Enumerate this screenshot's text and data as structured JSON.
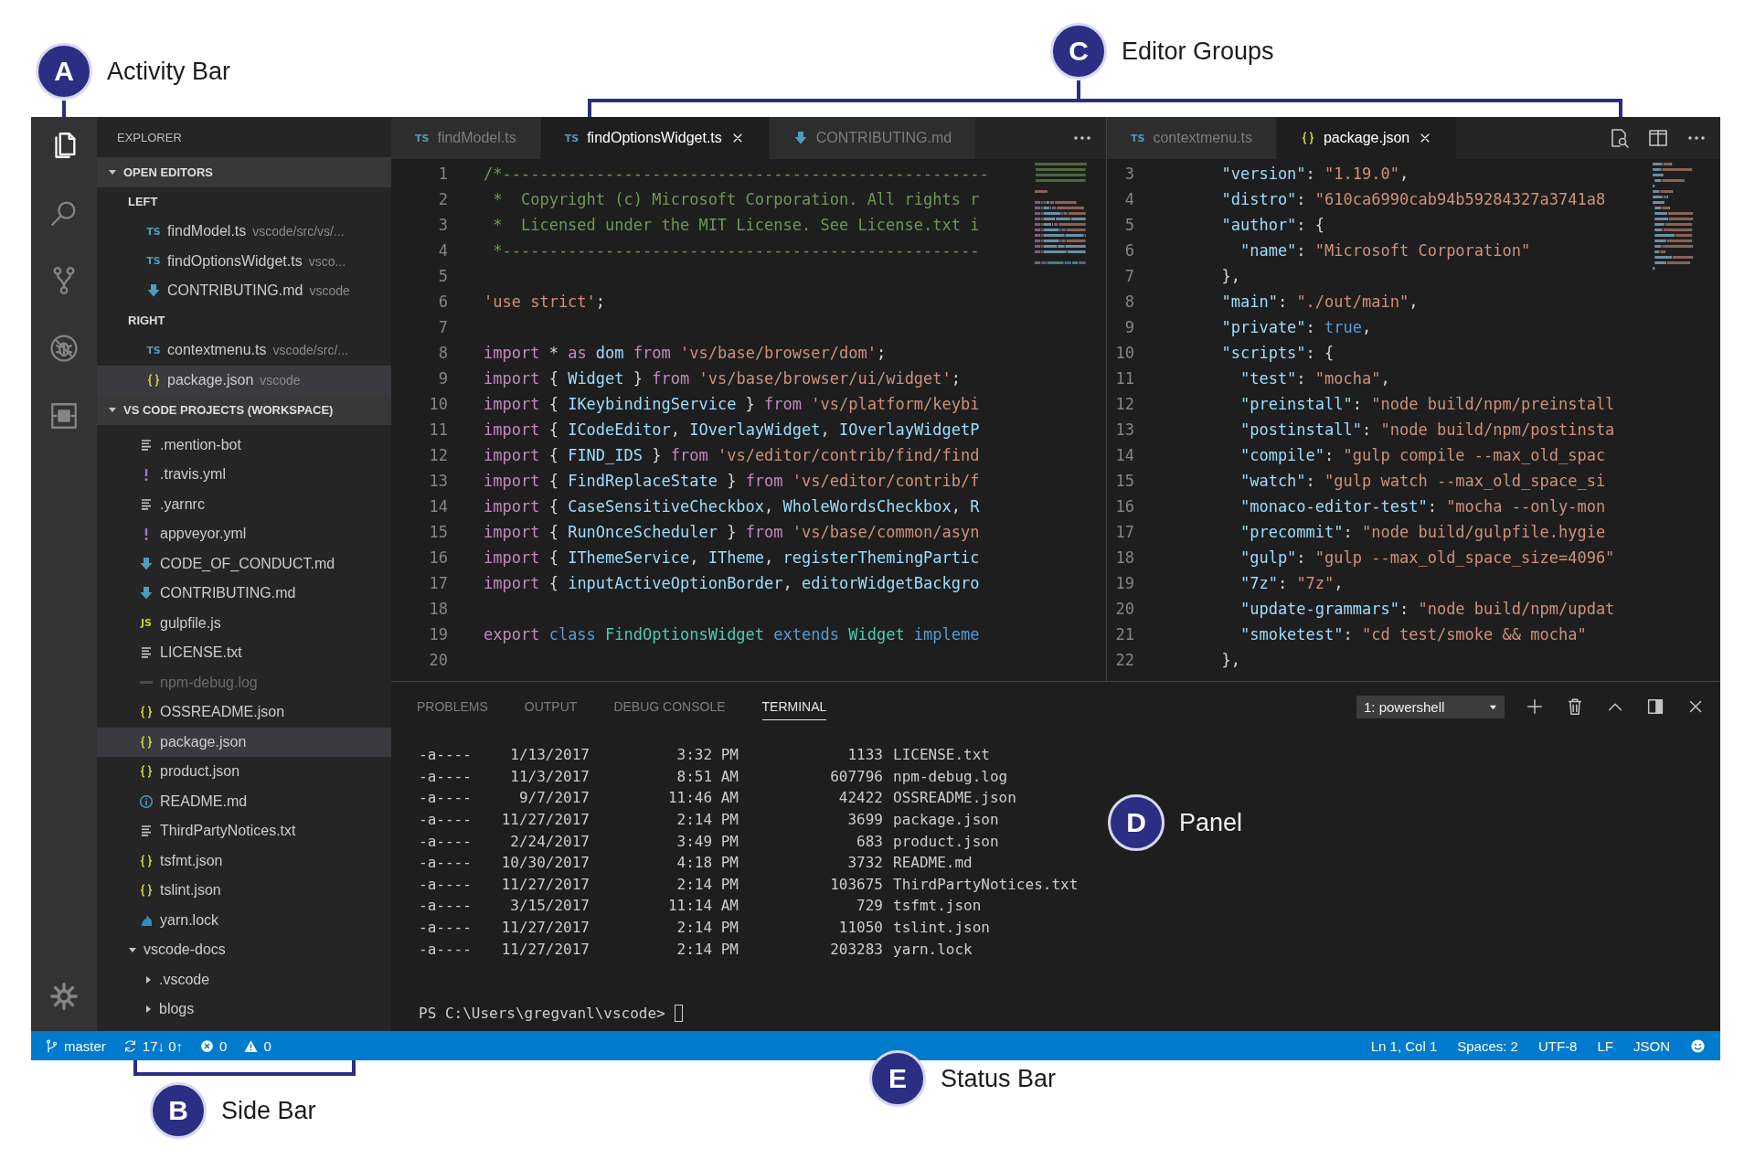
{
  "activity_bar": {
    "items": [
      {
        "kind": "files",
        "selected": true
      },
      {
        "kind": "search",
        "selected": false
      },
      {
        "kind": "source_control",
        "selected": false
      },
      {
        "kind": "debug",
        "selected": false
      },
      {
        "kind": "extensions",
        "selected": false
      }
    ]
  },
  "sidebar": {
    "title": "EXPLORER",
    "sections": [
      {
        "title": "OPEN EDITORS",
        "expanded": true,
        "groups": [
          {
            "title": "LEFT",
            "items": [
              {
                "name": "findModel.ts",
                "path": "vscode/src/vs/...",
                "kind": "ts",
                "badge": "TS",
                "selected": false
              },
              {
                "name": "findOptionsWidget.ts",
                "path": "vsco...",
                "kind": "ts",
                "badge": "TS",
                "selected": false
              },
              {
                "name": "CONTRIBUTING.md",
                "path": "vscode",
                "kind": "md",
                "selected": false
              }
            ]
          },
          {
            "title": "RIGHT",
            "items": [
              {
                "name": "contextmenu.ts",
                "path": "vscode/src/...",
                "kind": "ts",
                "badge": "TS",
                "selected": false
              },
              {
                "name": "package.json",
                "path": "vscode",
                "kind": "json",
                "selected": true
              }
            ]
          }
        ]
      },
      {
        "title": "VS CODE PROJECTS (WORKSPACE)",
        "expanded": true,
        "children": [
          {
            "kind": "txt",
            "name": ".mention-bot",
            "selected": false,
            "ignored": false
          },
          {
            "kind": "yml",
            "name": ".travis.yml",
            "selected": false,
            "ignored": false
          },
          {
            "kind": "txt",
            "name": ".yarnrc",
            "selected": false,
            "ignored": false
          },
          {
            "kind": "yml",
            "name": "appveyor.yml",
            "selected": false,
            "ignored": false
          },
          {
            "kind": "md",
            "name": "CODE_OF_CONDUCT.md",
            "selected": false,
            "ignored": false
          },
          {
            "kind": "md",
            "name": "CONTRIBUTING.md",
            "selected": false,
            "ignored": false
          },
          {
            "kind": "js",
            "name": "gulpfile.js",
            "badge": "JS",
            "selected": false,
            "ignored": false
          },
          {
            "kind": "txt",
            "name": "LICENSE.txt",
            "selected": false,
            "ignored": false
          },
          {
            "kind": "log",
            "name": "npm-debug.log",
            "selected": false,
            "ignored": true
          },
          {
            "kind": "json",
            "name": "OSSREADME.json",
            "selected": false,
            "ignored": false
          },
          {
            "kind": "json",
            "name": "package.json",
            "selected": true,
            "ignored": false
          },
          {
            "kind": "json",
            "name": "product.json",
            "selected": false,
            "ignored": false
          },
          {
            "kind": "info",
            "name": "README.md",
            "selected": false,
            "ignored": false
          },
          {
            "kind": "txt",
            "name": "ThirdPartyNotices.txt",
            "selected": false,
            "ignored": false
          },
          {
            "kind": "json",
            "name": "tsfmt.json",
            "selected": false,
            "ignored": false
          },
          {
            "kind": "json",
            "name": "tslint.json",
            "selected": false,
            "ignored": false
          },
          {
            "kind": "yarn",
            "name": "yarn.lock",
            "selected": false,
            "ignored": false
          },
          {
            "kind": "folder",
            "name": "vscode-docs",
            "expanded": true,
            "selected": false,
            "ignored": false,
            "children": [
              {
                "kind": "folder",
                "name": ".vscode",
                "expanded": false,
                "selected": false,
                "ignored": false
              },
              {
                "kind": "folder",
                "name": "blogs",
                "expanded": false,
                "selected": false,
                "ignored": false
              }
            ]
          }
        ]
      }
    ]
  },
  "editor_groups": [
    {
      "tabs": [
        {
          "name": "findModel.ts",
          "kind": "ts",
          "badge": "TS",
          "selected": false
        },
        {
          "name": "findOptionsWidget.ts",
          "kind": "ts",
          "badge": "TS",
          "selected": true
        },
        {
          "name": "CONTRIBUTING.md",
          "kind": "md",
          "selected": false
        }
      ],
      "actions": [
        {
          "kind": "more"
        }
      ],
      "lines": [
        {
          "number": "1",
          "tokens": [
            {
              "kind": "comment",
              "text": "/*----------------------------------------------------"
            }
          ]
        },
        {
          "number": "2",
          "tokens": [
            {
              "kind": "comment",
              "text": " *  Copyright (c) Microsoft Corporation. All rights r"
            }
          ]
        },
        {
          "number": "3",
          "tokens": [
            {
              "kind": "comment",
              "text": " *  Licensed under the MIT License. See License.txt i"
            }
          ]
        },
        {
          "number": "4",
          "tokens": [
            {
              "kind": "comment",
              "text": " *---------------------------------------------------"
            }
          ]
        },
        {
          "number": "5"
        },
        {
          "number": "6",
          "tokens": [
            {
              "kind": "string",
              "text": "'use strict'"
            },
            {
              "kind": "punct",
              "text": ";"
            }
          ]
        },
        {
          "number": "7"
        },
        {
          "number": "8",
          "tokens": [
            {
              "kind": "keyword",
              "text": "import"
            },
            {
              "kind": "punct",
              "text": " * "
            },
            {
              "kind": "keyword",
              "text": "as"
            },
            {
              "kind": "variable",
              "text": " dom "
            },
            {
              "kind": "keyword",
              "text": "from"
            },
            {
              "kind": "string",
              "text": " 'vs/base/browser/dom'"
            },
            {
              "kind": "punct",
              "text": ";"
            }
          ]
        },
        {
          "number": "9",
          "tokens": [
            {
              "kind": "keyword",
              "text": "import"
            },
            {
              "kind": "punct",
              "text": " { "
            },
            {
              "kind": "variable",
              "text": "Widget"
            },
            {
              "kind": "punct",
              "text": " } "
            },
            {
              "kind": "keyword",
              "text": "from"
            },
            {
              "kind": "string",
              "text": " 'vs/base/browser/ui/widget'"
            },
            {
              "kind": "punct",
              "text": ";"
            }
          ]
        },
        {
          "number": "10",
          "tokens": [
            {
              "kind": "keyword",
              "text": "import"
            },
            {
              "kind": "punct",
              "text": " { "
            },
            {
              "kind": "variable",
              "text": "IKeybindingService"
            },
            {
              "kind": "punct",
              "text": " } "
            },
            {
              "kind": "keyword",
              "text": "from"
            },
            {
              "kind": "string",
              "text": " 'vs/platform/keybi"
            }
          ]
        },
        {
          "number": "11",
          "tokens": [
            {
              "kind": "keyword",
              "text": "import"
            },
            {
              "kind": "punct",
              "text": " { "
            },
            {
              "kind": "variable",
              "text": "ICodeEditor"
            },
            {
              "kind": "punct",
              "text": ", "
            },
            {
              "kind": "variable",
              "text": "IOverlayWidget"
            },
            {
              "kind": "punct",
              "text": ", "
            },
            {
              "kind": "variable",
              "text": "IOverlayWidgetP"
            }
          ]
        },
        {
          "number": "12",
          "tokens": [
            {
              "kind": "keyword",
              "text": "import"
            },
            {
              "kind": "punct",
              "text": " { "
            },
            {
              "kind": "variable",
              "text": "FIND_IDS"
            },
            {
              "kind": "punct",
              "text": " } "
            },
            {
              "kind": "keyword",
              "text": "from"
            },
            {
              "kind": "string",
              "text": " 'vs/editor/contrib/find/find"
            }
          ]
        },
        {
          "number": "13",
          "tokens": [
            {
              "kind": "keyword",
              "text": "import"
            },
            {
              "kind": "punct",
              "text": " { "
            },
            {
              "kind": "variable",
              "text": "FindReplaceState"
            },
            {
              "kind": "punct",
              "text": " } "
            },
            {
              "kind": "keyword",
              "text": "from"
            },
            {
              "kind": "string",
              "text": " 'vs/editor/contrib/f"
            }
          ]
        },
        {
          "number": "14",
          "tokens": [
            {
              "kind": "keyword",
              "text": "import"
            },
            {
              "kind": "punct",
              "text": " { "
            },
            {
              "kind": "variable",
              "text": "CaseSensitiveCheckbox"
            },
            {
              "kind": "punct",
              "text": ", "
            },
            {
              "kind": "variable",
              "text": "WholeWordsCheckbox"
            },
            {
              "kind": "punct",
              "text": ", "
            },
            {
              "kind": "variable",
              "text": "R"
            }
          ]
        },
        {
          "number": "15",
          "tokens": [
            {
              "kind": "keyword",
              "text": "import"
            },
            {
              "kind": "punct",
              "text": " { "
            },
            {
              "kind": "variable",
              "text": "RunOnceScheduler"
            },
            {
              "kind": "punct",
              "text": " } "
            },
            {
              "kind": "keyword",
              "text": "from"
            },
            {
              "kind": "string",
              "text": " 'vs/base/common/asyn"
            }
          ]
        },
        {
          "number": "16",
          "tokens": [
            {
              "kind": "keyword",
              "text": "import"
            },
            {
              "kind": "punct",
              "text": " { "
            },
            {
              "kind": "variable",
              "text": "IThemeService"
            },
            {
              "kind": "punct",
              "text": ", "
            },
            {
              "kind": "variable",
              "text": "ITheme"
            },
            {
              "kind": "punct",
              "text": ", "
            },
            {
              "kind": "variable",
              "text": "registerThemingPartic"
            }
          ]
        },
        {
          "number": "17",
          "tokens": [
            {
              "kind": "keyword",
              "text": "import"
            },
            {
              "kind": "punct",
              "text": " { "
            },
            {
              "kind": "variable",
              "text": "inputActiveOptionBorder"
            },
            {
              "kind": "punct",
              "text": ", "
            },
            {
              "kind": "variable",
              "text": "editorWidgetBackgro"
            }
          ]
        },
        {
          "number": "18"
        },
        {
          "number": "19",
          "tokens": [
            {
              "kind": "keyword",
              "text": "export"
            },
            {
              "kind": "literal",
              "text": " class"
            },
            {
              "kind": "type",
              "text": " FindOptionsWidget"
            },
            {
              "kind": "literal",
              "text": " extends"
            },
            {
              "kind": "type",
              "text": " Widget"
            },
            {
              "kind": "literal",
              "text": " impleme"
            }
          ]
        },
        {
          "number": "20"
        }
      ]
    },
    {
      "tabs": [
        {
          "name": "contextmenu.ts",
          "kind": "ts",
          "badge": "TS",
          "selected": false
        },
        {
          "name": "package.json",
          "kind": "json",
          "selected": true
        }
      ],
      "actions": [
        {
          "kind": "preview"
        },
        {
          "kind": "split"
        },
        {
          "kind": "more"
        }
      ],
      "lines": [
        {
          "number": "3",
          "tokens": [
            {
              "kind": "key",
              "text": "  \"version\""
            },
            {
              "kind": "punct",
              "text": ": "
            },
            {
              "kind": "string",
              "text": "\"1.19.0\""
            },
            {
              "kind": "punct",
              "text": ","
            }
          ]
        },
        {
          "number": "4",
          "tokens": [
            {
              "kind": "key",
              "text": "  \"distro\""
            },
            {
              "kind": "punct",
              "text": ": "
            },
            {
              "kind": "string",
              "text": "\"610ca6990cab94b59284327a3741a8"
            }
          ]
        },
        {
          "number": "5",
          "tokens": [
            {
              "kind": "key",
              "text": "  \"author\""
            },
            {
              "kind": "punct",
              "text": ": {"
            }
          ]
        },
        {
          "number": "6",
          "tokens": [
            {
              "kind": "key",
              "text": "    \"name\""
            },
            {
              "kind": "punct",
              "text": ": "
            },
            {
              "kind": "string",
              "text": "\"Microsoft Corporation\""
            }
          ]
        },
        {
          "number": "7",
          "tokens": [
            {
              "kind": "punct",
              "text": "  },"
            }
          ]
        },
        {
          "number": "8",
          "tokens": [
            {
              "kind": "key",
              "text": "  \"main\""
            },
            {
              "kind": "punct",
              "text": ": "
            },
            {
              "kind": "string",
              "text": "\"./out/main\""
            },
            {
              "kind": "punct",
              "text": ","
            }
          ]
        },
        {
          "number": "9",
          "tokens": [
            {
              "kind": "key",
              "text": "  \"private\""
            },
            {
              "kind": "punct",
              "text": ": "
            },
            {
              "kind": "literal",
              "text": "true"
            },
            {
              "kind": "punct",
              "text": ","
            }
          ]
        },
        {
          "number": "10",
          "tokens": [
            {
              "kind": "key",
              "text": "  \"scripts\""
            },
            {
              "kind": "punct",
              "text": ": {"
            }
          ]
        },
        {
          "number": "11",
          "tokens": [
            {
              "kind": "key",
              "text": "    \"test\""
            },
            {
              "kind": "punct",
              "text": ": "
            },
            {
              "kind": "string",
              "text": "\"mocha\""
            },
            {
              "kind": "punct",
              "text": ","
            }
          ]
        },
        {
          "number": "12",
          "tokens": [
            {
              "kind": "key",
              "text": "    \"preinstall\""
            },
            {
              "kind": "punct",
              "text": ": "
            },
            {
              "kind": "string",
              "text": "\"node build/npm/preinstall"
            }
          ]
        },
        {
          "number": "13",
          "tokens": [
            {
              "kind": "key",
              "text": "    \"postinstall\""
            },
            {
              "kind": "punct",
              "text": ": "
            },
            {
              "kind": "string",
              "text": "\"node build/npm/postinsta"
            }
          ]
        },
        {
          "number": "14",
          "tokens": [
            {
              "kind": "key",
              "text": "    \"compile\""
            },
            {
              "kind": "punct",
              "text": ": "
            },
            {
              "kind": "string",
              "text": "\"gulp compile --max_old_spac"
            }
          ]
        },
        {
          "number": "15",
          "tokens": [
            {
              "kind": "key",
              "text": "    \"watch\""
            },
            {
              "kind": "punct",
              "text": ": "
            },
            {
              "kind": "string",
              "text": "\"gulp watch --max_old_space_si"
            }
          ]
        },
        {
          "number": "16",
          "tokens": [
            {
              "kind": "key",
              "text": "    \"monaco-editor-test\""
            },
            {
              "kind": "punct",
              "text": ": "
            },
            {
              "kind": "string",
              "text": "\"mocha --only-mon"
            }
          ]
        },
        {
          "number": "17",
          "tokens": [
            {
              "kind": "key",
              "text": "    \"precommit\""
            },
            {
              "kind": "punct",
              "text": ": "
            },
            {
              "kind": "string",
              "text": "\"node build/gulpfile.hygie"
            }
          ]
        },
        {
          "number": "18",
          "tokens": [
            {
              "kind": "key",
              "text": "    \"gulp\""
            },
            {
              "kind": "punct",
              "text": ": "
            },
            {
              "kind": "string",
              "text": "\"gulp --max_old_space_size=4096\""
            }
          ]
        },
        {
          "number": "19",
          "tokens": [
            {
              "kind": "key",
              "text": "    \"7z\""
            },
            {
              "kind": "punct",
              "text": ": "
            },
            {
              "kind": "string",
              "text": "\"7z\""
            },
            {
              "kind": "punct",
              "text": ","
            }
          ]
        },
        {
          "number": "20",
          "tokens": [
            {
              "kind": "key",
              "text": "    \"update-grammars\""
            },
            {
              "kind": "punct",
              "text": ": "
            },
            {
              "kind": "string",
              "text": "\"node build/npm/updat"
            }
          ]
        },
        {
          "number": "21",
          "tokens": [
            {
              "kind": "key",
              "text": "    \"smoketest\""
            },
            {
              "kind": "punct",
              "text": ": "
            },
            {
              "kind": "string",
              "text": "\"cd test/smoke && mocha\""
            }
          ]
        },
        {
          "number": "22",
          "tokens": [
            {
              "kind": "punct",
              "text": "  },"
            }
          ]
        }
      ]
    }
  ],
  "panel": {
    "tabs": [
      {
        "label": "PROBLEMS",
        "selected": false
      },
      {
        "label": "OUTPUT",
        "selected": false
      },
      {
        "label": "DEBUG CONSOLE",
        "selected": false
      },
      {
        "label": "TERMINAL",
        "selected": true
      }
    ],
    "terminal_select": "1: powershell",
    "actions": [
      {
        "kind": "add"
      },
      {
        "kind": "trash"
      },
      {
        "kind": "collapse"
      },
      {
        "kind": "maximize"
      },
      {
        "kind": "close"
      }
    ],
    "terminal": {
      "rows": [
        {
          "mode": "-a----",
          "date": "1/13/2017",
          "time": "3:32 PM",
          "size": "1133",
          "name": "LICENSE.txt"
        },
        {
          "mode": "-a----",
          "date": "11/3/2017",
          "time": "8:51 AM",
          "size": "607796",
          "name": "npm-debug.log"
        },
        {
          "mode": "-a----",
          "date": "9/7/2017",
          "time": "11:46 AM",
          "size": "42422",
          "name": "OSSREADME.json"
        },
        {
          "mode": "-a----",
          "date": "11/27/2017",
          "time": "2:14 PM",
          "size": "3699",
          "name": "package.json"
        },
        {
          "mode": "-a----",
          "date": "2/24/2017",
          "time": "3:49 PM",
          "size": "683",
          "name": "product.json"
        },
        {
          "mode": "-a----",
          "date": "10/30/2017",
          "time": "4:18 PM",
          "size": "3732",
          "name": "README.md"
        },
        {
          "mode": "-a----",
          "date": "11/27/2017",
          "time": "2:14 PM",
          "size": "103675",
          "name": "ThirdPartyNotices.txt"
        },
        {
          "mode": "-a----",
          "date": "3/15/2017",
          "time": "11:14 AM",
          "size": "729",
          "name": "tsfmt.json"
        },
        {
          "mode": "-a----",
          "date": "11/27/2017",
          "time": "2:14 PM",
          "size": "11050",
          "name": "tslint.json"
        },
        {
          "mode": "-a----",
          "date": "11/27/2017",
          "time": "2:14 PM",
          "size": "203283",
          "name": "yarn.lock"
        }
      ],
      "prompt": "PS C:\\Users\\gregvanl\\vscode>"
    }
  },
  "status_bar": {
    "left": [
      {
        "kind": "branch",
        "text": "master"
      },
      {
        "kind": "sync",
        "text": "17↓ 0↑"
      },
      {
        "kind": "errors",
        "text": "0"
      },
      {
        "kind": "warnings",
        "text": "0"
      }
    ],
    "right": [
      {
        "kind": "text",
        "text": "Ln 1, Col 1"
      },
      {
        "kind": "text",
        "text": "Spaces: 2"
      },
      {
        "kind": "text",
        "text": "UTF-8"
      },
      {
        "kind": "text",
        "text": "LF"
      },
      {
        "kind": "text",
        "text": "JSON"
      },
      {
        "kind": "feedback"
      }
    ]
  },
  "callouts": [
    {
      "letter": "A",
      "label": "Activity Bar"
    },
    {
      "letter": "B",
      "label": "Side Bar"
    },
    {
      "letter": "C",
      "label": "Editor Groups"
    },
    {
      "letter": "D",
      "label": "Panel"
    },
    {
      "letter": "E",
      "label": "Status Bar"
    }
  ]
}
